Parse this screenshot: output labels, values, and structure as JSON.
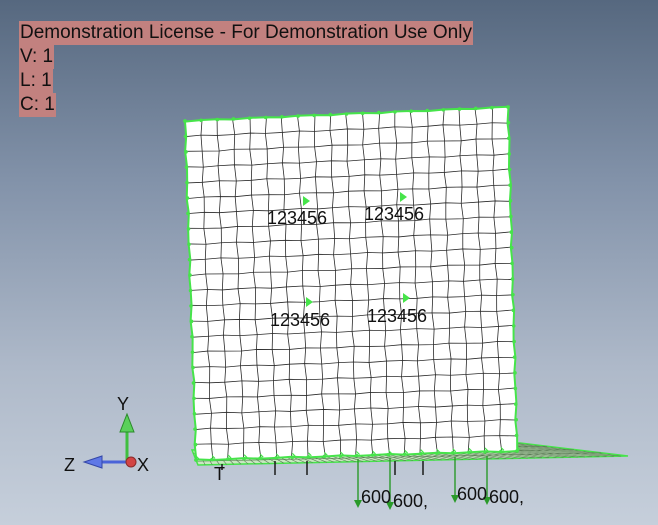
{
  "viewport": {
    "license_banner": "Demonstration License - For Demonstration Use Only",
    "counters": [
      "V: 1",
      "L: 1",
      "C: 1"
    ]
  },
  "mesh": {
    "constraint_labels": [
      "123456",
      "123456",
      "123456",
      "123456"
    ],
    "load_labels": [
      "600",
      "600,",
      "600",
      "600,"
    ],
    "base_label": "T"
  },
  "triad": {
    "x_label": "X",
    "y_label": "Y",
    "z_label": "Z"
  },
  "colors": {
    "mesh_edge": "#46e44a",
    "mesh_face": "#ffffff",
    "element_line": "#2a2a2a",
    "banner_bg": "#c2817f",
    "load_arrow": "#2a9a2a",
    "triad_y": "#3fbf3f",
    "triad_z": "#4a63d8",
    "triad_x": "#c83a3a"
  }
}
